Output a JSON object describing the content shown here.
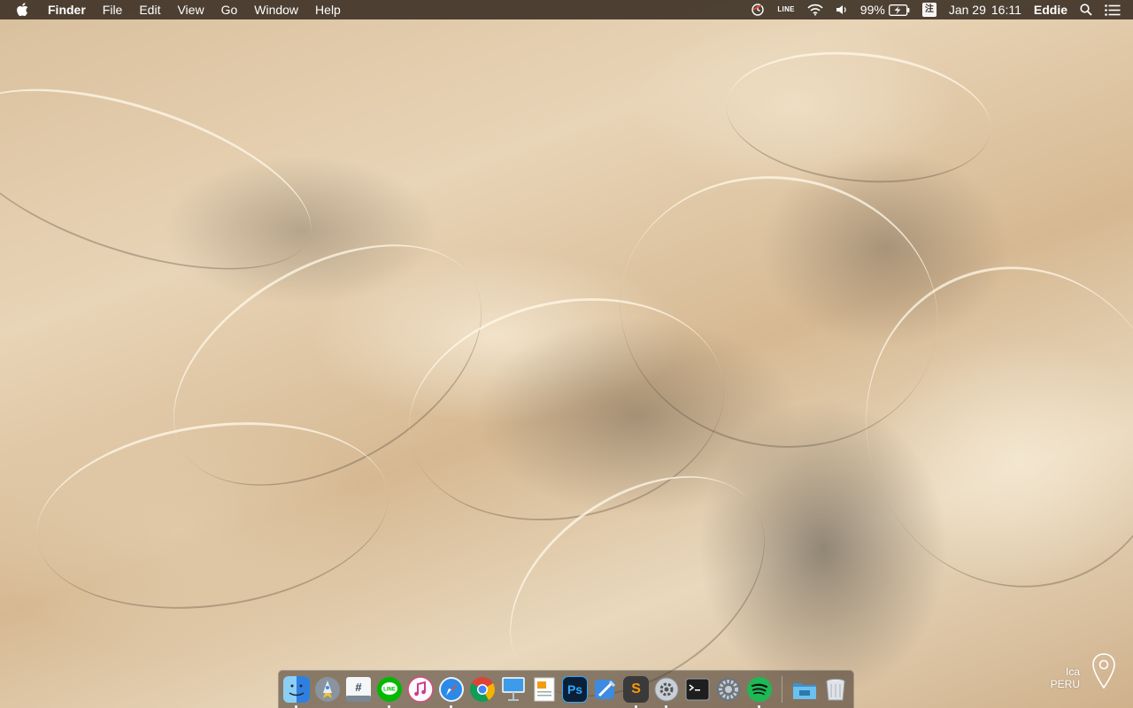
{
  "menubar": {
    "apple_icon": "apple-logo-icon",
    "app_name": "Finder",
    "menus": [
      "File",
      "Edit",
      "View",
      "Go",
      "Window",
      "Help"
    ],
    "status": {
      "line_label": "LINE",
      "battery_percent": "99%",
      "input_method": "注",
      "date": "Jan 29",
      "time": "16:11",
      "user": "Eddie"
    }
  },
  "dock": {
    "apps": [
      {
        "name": "Finder",
        "icon": "finder-icon",
        "color": "#3a8ee6",
        "running": true
      },
      {
        "name": "Launchpad",
        "icon": "launchpad-icon",
        "color": "#6c7a89",
        "running": false
      },
      {
        "name": "Slack",
        "icon": "slack-icon",
        "color": "#dfe6ee",
        "running": false
      },
      {
        "name": "LINE",
        "icon": "line-icon",
        "color": "#00b900",
        "running": true
      },
      {
        "name": "iTunes",
        "icon": "itunes-icon",
        "color": "#f5f5f7",
        "running": false
      },
      {
        "name": "Safari",
        "icon": "safari-icon",
        "color": "#1e88e5",
        "running": true
      },
      {
        "name": "Chrome",
        "icon": "chrome-icon",
        "color": "#ffffff",
        "running": false
      },
      {
        "name": "Keynote",
        "icon": "keynote-icon",
        "color": "#2f8fd8",
        "running": false
      },
      {
        "name": "Pages",
        "icon": "pages-icon",
        "color": "#f0a030",
        "running": false
      },
      {
        "name": "Photoshop",
        "icon": "photoshop-icon",
        "color": "#0b2036",
        "running": false
      },
      {
        "name": "Xcode",
        "icon": "xcode-icon",
        "color": "#3d8be0",
        "running": false
      },
      {
        "name": "Sublime Text",
        "icon": "sublime-icon",
        "color": "#3a3a3a",
        "running": true
      },
      {
        "name": "System Preferences Utility",
        "icon": "utility-icon",
        "color": "#c9cfd6",
        "running": true
      },
      {
        "name": "Terminal",
        "icon": "terminal-icon",
        "color": "#1e1e1e",
        "running": false
      },
      {
        "name": "System Preferences",
        "icon": "preferences-icon",
        "color": "#7d8790",
        "running": false
      },
      {
        "name": "Spotify",
        "icon": "spotify-icon",
        "color": "#1db954",
        "running": true
      }
    ],
    "folders": [
      {
        "name": "Applications",
        "icon": "folder-icon",
        "color": "#4aa3d8"
      },
      {
        "name": "Trash",
        "icon": "trash-icon",
        "color": "#d9dde2"
      }
    ],
    "ps_label": "Ps",
    "sublime_label": "S"
  },
  "wallpaper": {
    "location_city": "Ica",
    "location_country": "PERU",
    "pin_icon": "location-pin-icon"
  }
}
